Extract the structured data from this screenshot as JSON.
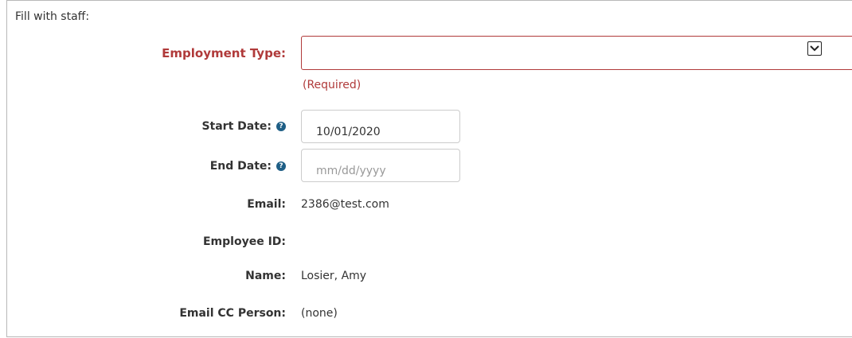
{
  "section": {
    "title": "Fill with staff:"
  },
  "employment_type": {
    "label": "Employment Type:",
    "value": "",
    "required_note": "(Required)"
  },
  "start_date": {
    "label": "Start Date:",
    "value": "10/01/2020",
    "placeholder": "mm/dd/yyyy"
  },
  "end_date": {
    "label": "End Date:",
    "value": "",
    "placeholder": "mm/dd/yyyy"
  },
  "email": {
    "label": "Email:",
    "value": "2386@test.com"
  },
  "employee_id": {
    "label": "Employee ID:",
    "value": ""
  },
  "name": {
    "label": "Name:",
    "value": "Losier, Amy"
  },
  "email_cc": {
    "label": "Email CC Person:",
    "value": "(none)"
  },
  "icons": {
    "help": "question-circle-icon",
    "select_arrow": "chevron-down-icon"
  },
  "colors": {
    "required": "#b03a3a",
    "help_icon": "#1f5f86",
    "input_border": "#cccccc"
  }
}
